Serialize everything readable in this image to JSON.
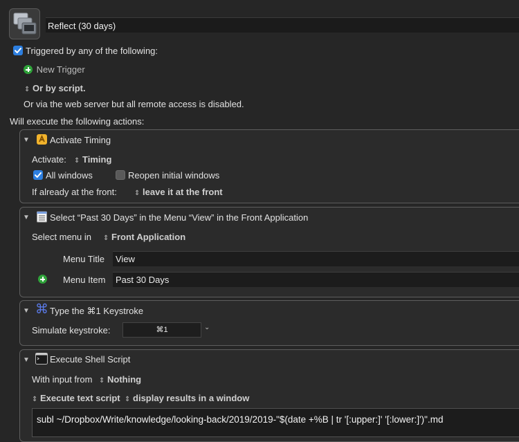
{
  "macro": {
    "name": "Reflect (30 days)"
  },
  "triggers": {
    "enabled": true,
    "label": "Triggered by any of the following:",
    "new_trigger": "New Trigger",
    "or_by_script": "Or by script.",
    "web_server_note": "Or via the web server but all remote access is disabled."
  },
  "actions_label": "Will execute the following actions:",
  "actions": {
    "activate": {
      "title": "Activate Timing",
      "activate_label": "Activate:",
      "app": "Timing",
      "all_windows_label": "All windows",
      "all_windows": true,
      "reopen_label": "Reopen initial windows",
      "reopen": false,
      "front_label": "If already at the front:",
      "front_option": "leave it at the front"
    },
    "menu": {
      "title": "Select “Past 30 Days” in the Menu “View” in the Front Application",
      "select_menu_label": "Select menu in",
      "app": "Front Application",
      "menu_title_label": "Menu Title",
      "menu_title_value": "View",
      "menu_item_label": "Menu Item",
      "menu_item_value": "Past 30 Days"
    },
    "keystroke": {
      "title": "Type the ⌘1 Keystroke",
      "simulate_label": "Simulate keystroke:",
      "keystroke": "⌘1"
    },
    "shell": {
      "title": "Execute Shell Script",
      "input_label": "With input from",
      "input_value": "Nothing",
      "mode": "Execute text script",
      "output": "display results in a window",
      "script": "subl ~/Dropbox/Write/knowledge/looking-back/2019/2019-\"$(date +%B | tr '[:upper:]' '[:lower:]')\".md"
    }
  },
  "colors": {
    "background": "#262626",
    "panel": "#2b2b2b",
    "checkbox_on": "#2d7fe0",
    "add_green": "#2fa33a",
    "command_icon": "#5b7bea"
  }
}
